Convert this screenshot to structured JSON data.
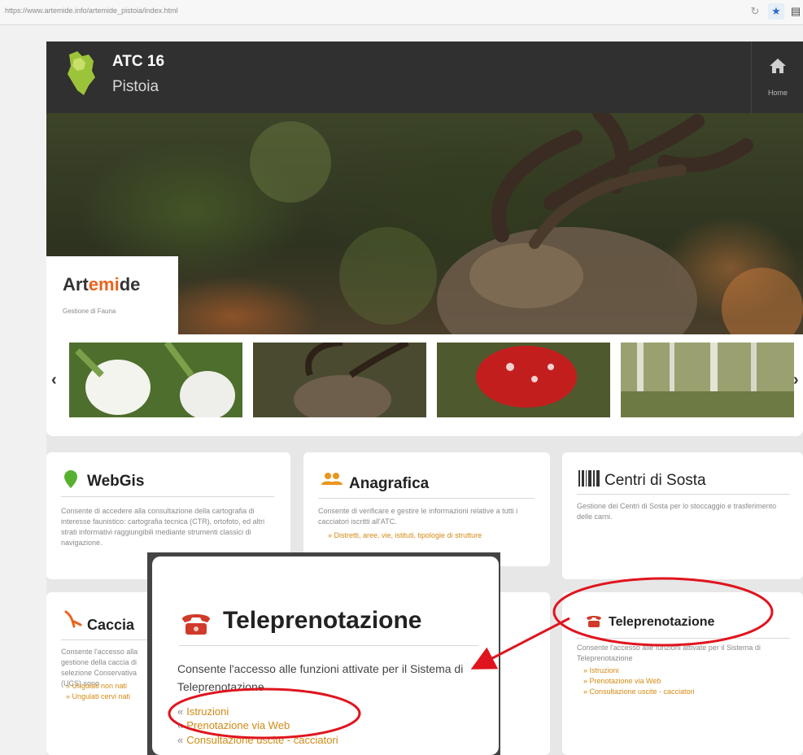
{
  "browser": {
    "url": "https://www.artemide.info/artemide_pistoia/index.html"
  },
  "header": {
    "org_name": "ATC 16",
    "org_city": "Pistoia",
    "home_label": "Home"
  },
  "hero": {
    "title_part1": "Art",
    "title_part2": "emi",
    "title_part3": "de",
    "subtitle": "Gestione di Fauna"
  },
  "gallery": {
    "prev": "‹",
    "next": "›"
  },
  "cards": {
    "webgis": {
      "title": "WebGis",
      "text": "Consente di accedere alla consultazione della cartografia di interesse faunistico: cartografia tecnica (CTR), ortofoto, ed altri strati informativi raggiungibili mediante strumenti classici di navigazione."
    },
    "anagrafica": {
      "title": "Anagrafica",
      "text": "Consente di verificare e gestire le informazioni relative a tutti i cacciatori iscritti all'ATC.",
      "link": "» Distretti, aree, vie, istituti, tipologie di strutture"
    },
    "centri": {
      "title": "Centri di Sosta",
      "text": "Gestione dei Centri di Sosta per lo stoccaggio e trasferimento delle carni."
    },
    "caccia": {
      "title": "Caccia",
      "text": "Consente l'accesso alla gestione della caccia di selezione Conservativa (UCS) sono",
      "link1": "» Ungulati non nati",
      "link2": "» Ungulati cervi nati"
    },
    "teleprenotazione": {
      "title": "Teleprenotazione",
      "text": "Consente l'accesso alle funzioni attivate per il Sistema di Teleprenotazione",
      "links": [
        "» Istruzioni",
        "» Prenotazione via Web",
        "» Consultazione uscite - cacciatori"
      ]
    }
  },
  "popup": {
    "title": "Teleprenotazione",
    "description": "Consente l'accesso alle funzioni attivate per il Sistema di Teleprenotazione",
    "links": [
      "Istruzioni",
      "Prenotazione via Web",
      "Consultazione uscite - cacciatori"
    ]
  },
  "colors": {
    "accent": "#e8641e",
    "link": "#d48a12",
    "annotation": "#e0141e",
    "nav_bg": "#303030"
  }
}
